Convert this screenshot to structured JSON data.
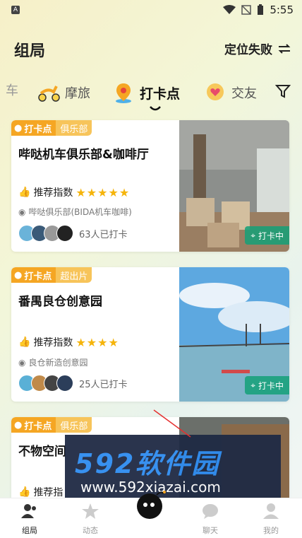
{
  "status": {
    "time": "5:55"
  },
  "header": {
    "title": "组局",
    "location": "定位失败"
  },
  "tabs": [
    {
      "label": "车"
    },
    {
      "label": "摩旅"
    },
    {
      "label": "打卡点"
    },
    {
      "label": "交友"
    }
  ],
  "cards": [
    {
      "badge_main": "打卡点",
      "badge_sub": "俱乐部",
      "name": "哔哒机车俱乐部&咖啡厅",
      "rating_label": "推荐指数",
      "stars": "★★★★★",
      "address": "哔哒俱乐部(BIDA机车咖啡)",
      "count": "63人已打卡",
      "status": "打卡中"
    },
    {
      "badge_main": "打卡点",
      "badge_sub": "超出片",
      "name": "番禺良仓创意园",
      "rating_label": "推荐指数",
      "stars": "★★★★",
      "address": "良仓新造创意园",
      "count": "25人已打卡",
      "status": "打卡中"
    },
    {
      "badge_main": "打卡点",
      "badge_sub": "俱乐部",
      "name": "不物空间",
      "rating_label": "推荐指",
      "stars": "",
      "address": "",
      "count": "",
      "status": ""
    }
  ],
  "watermark": {
    "line1": "592软件园",
    "line2": "www.592xiazai.com"
  },
  "nav": [
    {
      "label": "组局"
    },
    {
      "label": "动态"
    },
    {
      "label": "聊天"
    },
    {
      "label": "我的"
    }
  ],
  "colors": {
    "accent": "#f5a623",
    "checkin": "#14a078",
    "star": "#f5b40b"
  }
}
